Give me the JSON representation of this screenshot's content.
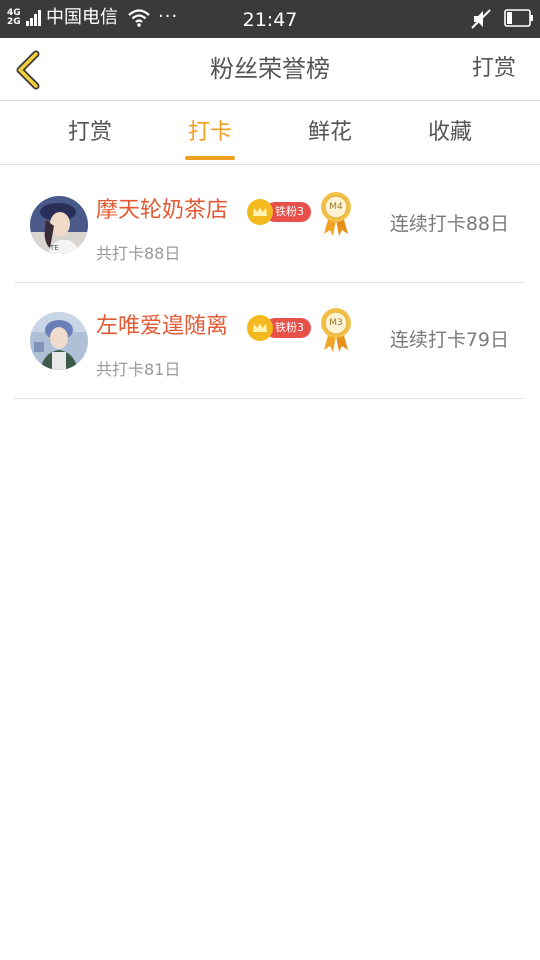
{
  "status_bar": {
    "network_top": "4G",
    "network_bottom": "2G",
    "carrier": "中国电信",
    "dots": "···",
    "time": "21:47"
  },
  "nav": {
    "title": "粉丝荣誉榜",
    "action": "打赏"
  },
  "tabs": [
    {
      "label": "打赏",
      "active": false
    },
    {
      "label": "打卡",
      "active": true
    },
    {
      "label": "鲜花",
      "active": false
    },
    {
      "label": "收藏",
      "active": false
    }
  ],
  "colors": {
    "accent": "#f0a020",
    "username": "#e35a35",
    "badge_red": "#e8514a",
    "status_bar": "#3a3a3a"
  },
  "fans": [
    {
      "name": "摩天轮奶茶店",
      "badge": "铁粉3",
      "medal": "M4",
      "total": "共打卡88日",
      "streak": "连续打卡88日"
    },
    {
      "name": "左唯爱遑随离",
      "badge": "铁粉3",
      "medal": "M3",
      "total": "共打卡81日",
      "streak": "连续打卡79日"
    }
  ]
}
